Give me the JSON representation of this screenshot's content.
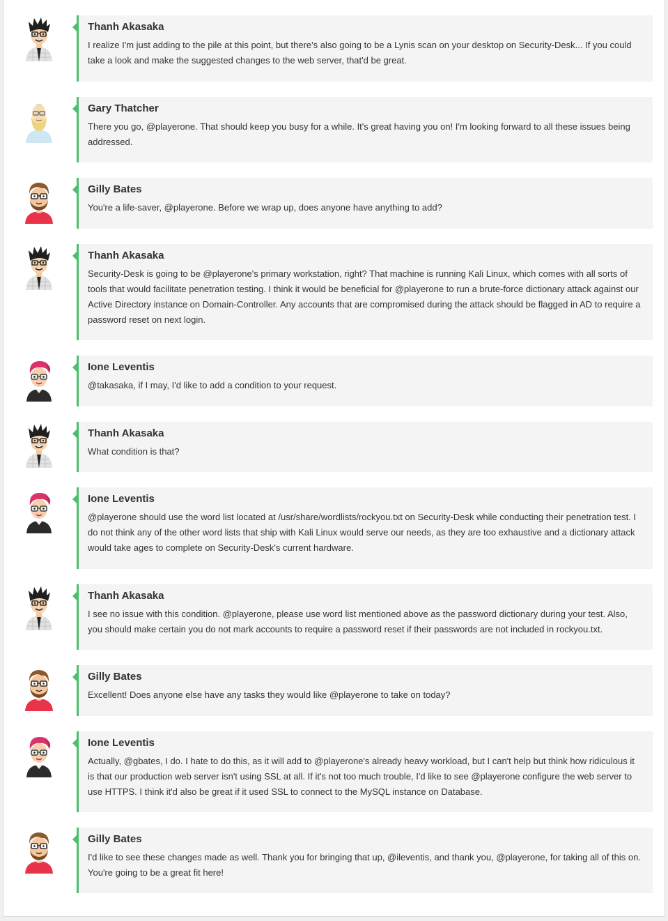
{
  "colors": {
    "accent": "#4cbf6f",
    "bubble_bg": "#f4f4f4",
    "text": "#333333"
  },
  "messages": [
    {
      "author": "Thanh Akasaka",
      "avatar": "thanh-akasaka-avatar",
      "text": "I realize I'm just adding to the pile at this point, but there's also going to be a Lynis scan on your desktop on Security-Desk... If you could take a look and make the suggested changes to the web server, that'd be great."
    },
    {
      "author": "Gary Thatcher",
      "avatar": "gary-thatcher-avatar",
      "text": "There you go, @playerone. That should keep you busy for a while. It's great having you on! I'm looking forward to all these issues being addressed."
    },
    {
      "author": "Gilly Bates",
      "avatar": "gilly-bates-avatar",
      "text": "You're a life-saver, @playerone. Before we wrap up, does anyone have anything to add?"
    },
    {
      "author": "Thanh Akasaka",
      "avatar": "thanh-akasaka-avatar",
      "text": "Security-Desk is going to be @playerone's primary workstation, right? That machine is running Kali Linux, which comes with all sorts of tools that would facilitate penetration testing. I think it would be beneficial for @playerone to run a brute-force dictionary attack against our Active Directory instance on Domain-Controller. Any accounts that are compromised during the attack should be flagged in AD to require a password reset on next login."
    },
    {
      "author": "Ione Leventis",
      "avatar": "ione-leventis-avatar",
      "text": "@takasaka, if I may, I'd like to add a condition to your request."
    },
    {
      "author": "Thanh Akasaka",
      "avatar": "thanh-akasaka-avatar",
      "text": "What condition is that?"
    },
    {
      "author": "Ione Leventis",
      "avatar": "ione-leventis-avatar",
      "text": "@playerone should use the word list located at /usr/share/wordlists/rockyou.txt on Security-Desk while conducting their penetration test. I do not think any of the other word lists that ship with Kali Linux would serve our needs, as they are too exhaustive and a dictionary attack would take ages to complete on Security-Desk's current hardware."
    },
    {
      "author": "Thanh Akasaka",
      "avatar": "thanh-akasaka-avatar",
      "text": "I see no issue with this condition. @playerone, please use word list mentioned above as the password dictionary during your test. Also, you should make certain you do not mark accounts to require a password reset if their passwords are not included in rockyou.txt."
    },
    {
      "author": "Gilly Bates",
      "avatar": "gilly-bates-avatar",
      "text": "Excellent! Does anyone else have any tasks they would like @playerone to take on today?"
    },
    {
      "author": "Ione Leventis",
      "avatar": "ione-leventis-avatar",
      "text": "Actually, @gbates, I do. I hate to do this, as it will add to @playerone's already heavy workload, but I can't help but think how ridiculous it is that our production web server isn't using SSL at all. If it's not too much trouble, I'd like to see @playerone configure the web server to use HTTPS. I think it'd also be great if it used SSL to connect to the MySQL instance on Database."
    },
    {
      "author": "Gilly Bates",
      "avatar": "gilly-bates-avatar",
      "text": "I'd like to see these changes made as well. Thank you for bringing that up, @ileventis, and thank you, @playerone, for taking all of this on. You're going to be a great fit here!"
    }
  ]
}
